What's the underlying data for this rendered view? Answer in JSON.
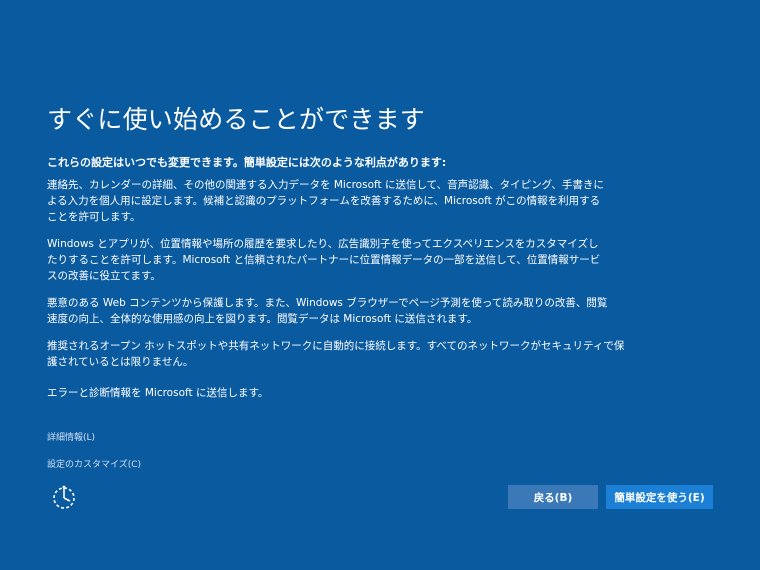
{
  "title": "すぐに使い始めることができます",
  "subtitle": "これらの設定はいつでも変更できます。簡単設定には次のような利点があります:",
  "paragraphs": [
    {
      "lines": [
        "連絡先、カレンダーの詳細、その他の関連する入力データを Microsoft に送信して、音声認識、タイピング、手書きに",
        "よる入力を個人用に設定します。候補と認識のプラットフォームを改善するために、Microsoft がこの情報を利用する",
        "ことを許可します。"
      ]
    },
    {
      "lines": [
        "Windows とアプリが、位置情報や場所の履歴を要求したり、広告識別子を使ってエクスペリエンスをカスタマイズし",
        "たりすることを許可します。Microsoft と信頼されたパートナーに位置情報データの一部を送信して、位置情報サービ",
        "スの改善に役立てます。"
      ]
    },
    {
      "lines": [
        "悪意のある Web コンテンツから保護します。また、Windows ブラウザーでページ予測を使って読み取りの改善、閲覧",
        "速度の向上、全体的な使用感の向上を図ります。閲覧データは Microsoft に送信されます。"
      ]
    },
    {
      "lines": [
        "推奨されるオープン ホットスポットや共有ネットワークに自動的に接続します。すべてのネットワークがセキュリティで保",
        "護されているとは限りません。"
      ]
    },
    {
      "lines": [
        "エラーと診断情報を Microsoft に送信します。"
      ]
    }
  ],
  "links": {
    "more_info": "詳細情報(L)",
    "customize": "設定のカスタマイズ(C)"
  },
  "buttons": {
    "back": "戻る(B)",
    "express": "簡単設定を使う(E)"
  },
  "icons": {
    "accessibility": "ease-of-access-icon"
  },
  "colors": {
    "background": "#0a5aa0",
    "back_button": "#3a78b7",
    "primary_button": "#1b7fd6"
  }
}
